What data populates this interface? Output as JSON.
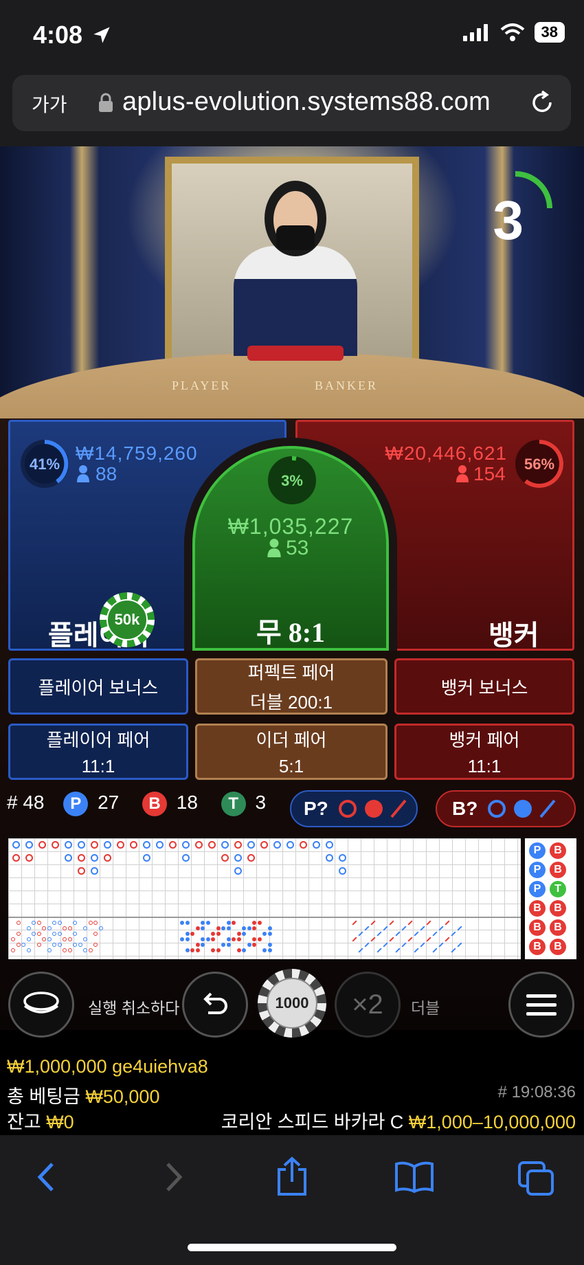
{
  "status_bar": {
    "time": "4:08",
    "battery": "38"
  },
  "browser": {
    "text_size": "가가",
    "url": "aplus-evolution.systems88.com"
  },
  "video": {
    "countdown": "3",
    "table_player": "PLAYER",
    "table_banker": "BANKER"
  },
  "bets": {
    "player": {
      "percent": "41%",
      "amount": "₩14,759,260",
      "players": "88",
      "label": "플레이어",
      "chip": "50k"
    },
    "tie": {
      "percent": "3%",
      "amount": "₩1,035,227",
      "players": "53",
      "label": "무 8:1"
    },
    "banker": {
      "percent": "56%",
      "amount": "₩20,446,621",
      "players": "154",
      "label": "뱅커"
    }
  },
  "side_bets": {
    "player_bonus": "플레이어 보너스",
    "perfect_pair": "퍼펙트 페어",
    "perfect_pair_odds": "더블 200:1",
    "banker_bonus": "뱅커 보너스",
    "player_pair": "플레이어 페어",
    "player_pair_odds": "11:1",
    "either_pair": "이더 페어",
    "either_pair_odds": "5:1",
    "banker_pair": "뱅커 페어",
    "banker_pair_odds": "11:1"
  },
  "stats": {
    "round": "# 48",
    "p_label": "P",
    "p_count": "27",
    "b_label": "B",
    "b_count": "18",
    "t_label": "T",
    "t_count": "3"
  },
  "predict": {
    "player": "P?",
    "banker": "B?"
  },
  "controls": {
    "undo_label": "실행 취소하다",
    "chip_value": "1000",
    "double_symbol": "×2",
    "double_label": "더블"
  },
  "info": {
    "balance_user": "₩1,000,000 ge4uiehva8",
    "total_bet_label": "총 베팅금",
    "total_bet": "₩50,000",
    "game_id": "# 19:08:36",
    "balance_label": "잔고",
    "balance": "₩0",
    "table_name": "코리안 스피드 바카라 C",
    "limits": "₩1,000–10,000,000"
  },
  "colors": {
    "player_blue": "#3b82f6",
    "banker_red": "#e53935",
    "tie_green": "#3fc03f",
    "gold": "#f6d23a"
  }
}
